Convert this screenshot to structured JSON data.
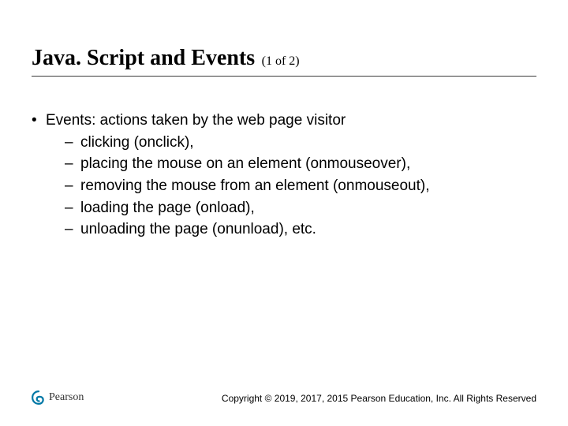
{
  "title": {
    "main": "Java. Script and Events",
    "sub": "(1 of 2)"
  },
  "bullets": {
    "level1": "Events: actions taken by the web page visitor",
    "level2": [
      "clicking (onclick),",
      "placing the mouse on an element (onmouseover),",
      "removing the mouse from an element (onmouseout),",
      "loading the page (onload),",
      "unloading the page (onunload), etc."
    ]
  },
  "footer": {
    "logo_text": "Pearson",
    "copyright": "Copyright © 2019, 2017, 2015 Pearson Education, Inc. All Rights Reserved"
  },
  "markers": {
    "bullet": "•",
    "dash": "–"
  }
}
